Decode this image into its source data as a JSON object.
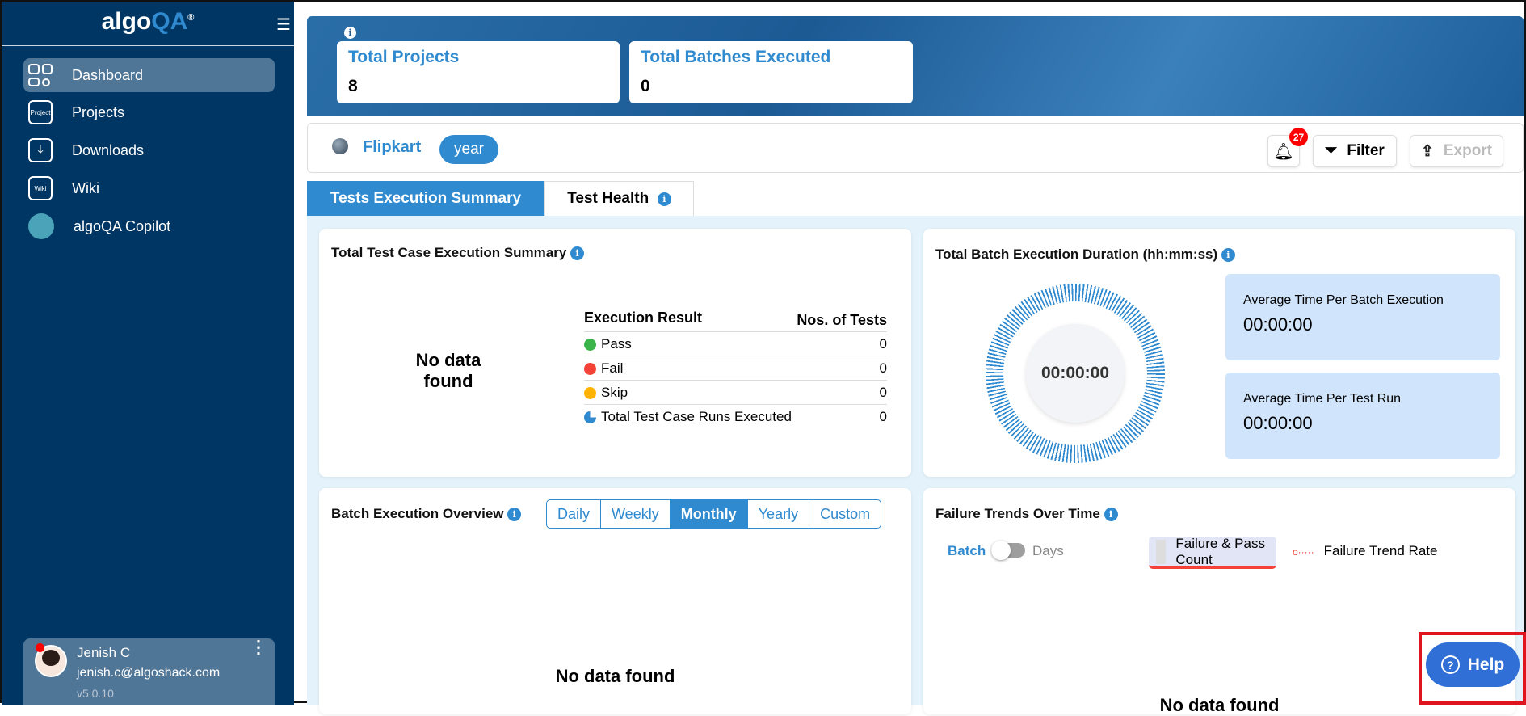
{
  "sidebar": {
    "logo_main": "algo",
    "logo_accent": "QA",
    "logo_mark": "®",
    "items": [
      {
        "label": "Dashboard",
        "icon": "dashboard-icon"
      },
      {
        "label": "Projects",
        "icon": "project-icon"
      },
      {
        "label": "Downloads",
        "icon": "download-icon"
      },
      {
        "label": "Wiki",
        "icon": "wiki-icon"
      },
      {
        "label": "algoQA Copilot",
        "icon": "copilot-avatar"
      }
    ],
    "project_icon_text": "Project",
    "wiki_icon_text": "Wiki",
    "user": {
      "name": "Jenish C",
      "email": "jenish.c@algoshack.com",
      "version": "v5.0.10"
    }
  },
  "banner": {
    "stats": [
      {
        "label": "Total Projects",
        "value": "8"
      },
      {
        "label": "Total Batches Executed",
        "value": "0"
      }
    ]
  },
  "toolbar": {
    "project": "Flipkart",
    "period": "year",
    "notifications": "27",
    "filter": "Filter",
    "export": "Export"
  },
  "tabs": [
    {
      "label": "Tests Execution Summary",
      "active": true
    },
    {
      "label": "Test Health",
      "active": false
    }
  ],
  "summary": {
    "title": "Total Test Case Execution Summary",
    "empty": "No data found",
    "col1": "Execution Result",
    "col2": "Nos. of Tests",
    "rows": [
      {
        "label": "Pass",
        "value": "0",
        "color": "#3bb54a"
      },
      {
        "label": "Fail",
        "value": "0",
        "color": "#f44336"
      },
      {
        "label": "Skip",
        "value": "0",
        "color": "#ffb300"
      },
      {
        "label": "Total Test Case Runs Executed",
        "value": "0"
      }
    ]
  },
  "duration": {
    "title": "Total Batch Execution Duration (hh:mm:ss)",
    "center": "00:00:00",
    "avg_batch_label": "Average Time Per Batch Execution",
    "avg_batch": "00:00:00",
    "avg_test_label": "Average Time Per Test Run",
    "avg_test": "00:00:00"
  },
  "overview": {
    "title": "Batch Execution Overview",
    "ranges": [
      "Daily",
      "Weekly",
      "Monthly",
      "Yearly",
      "Custom"
    ],
    "selected": "Monthly",
    "empty": "No data found"
  },
  "trends": {
    "title": "Failure Trends Over Time",
    "toggle_left": "Batch",
    "toggle_right": "Days",
    "legend1": "Failure & Pass Count",
    "legend2": "Failure Trend Rate",
    "empty": "No data found"
  },
  "help": "Help"
}
